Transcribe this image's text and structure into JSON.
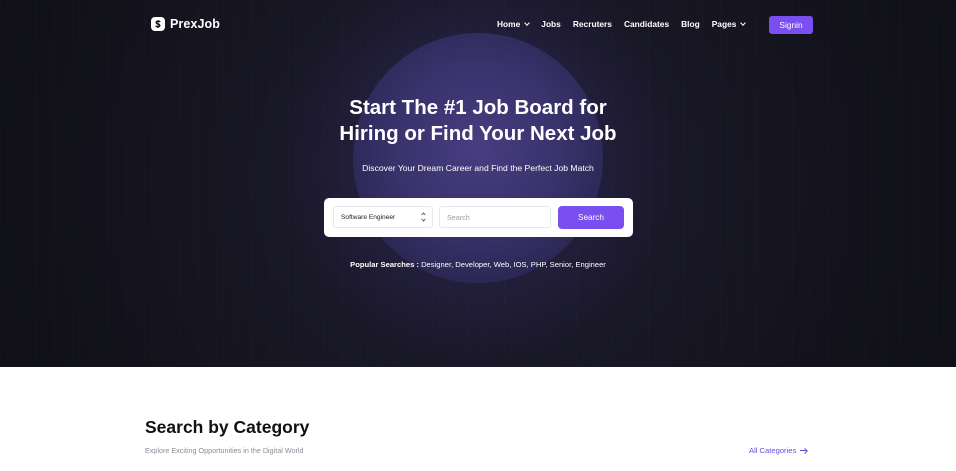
{
  "brand": {
    "name": "PrexJob",
    "logo_icon": "dollar-badge-icon"
  },
  "nav": {
    "items": [
      {
        "label": "Home",
        "has_dropdown": true
      },
      {
        "label": "Jobs",
        "has_dropdown": false
      },
      {
        "label": "Recruters",
        "has_dropdown": false
      },
      {
        "label": "Candidates",
        "has_dropdown": false
      },
      {
        "label": "Blog",
        "has_dropdown": false
      },
      {
        "label": "Pages",
        "has_dropdown": true
      }
    ],
    "signin_label": "Signin"
  },
  "hero": {
    "title_line1": "Start The #1 Job Board for",
    "title_line2": "Hiring or Find Your Next Job",
    "subtitle": "Discover Your Dream Career and Find the Perfect Job Match"
  },
  "search": {
    "category_selected": "Software Engineer",
    "input_placeholder": "Search",
    "button_label": "Search"
  },
  "popular": {
    "label": "Popular Searches :",
    "terms": [
      "Designer",
      "Developer",
      "Web",
      "IOS",
      "PHP",
      "Senior",
      "Engineer"
    ]
  },
  "category_section": {
    "title": "Search by Category",
    "subtitle": "Explore Exciting Opportunities in the Digital World",
    "link_label": "All Categories"
  },
  "colors": {
    "accent": "#7a4ff0",
    "hero_bg": "#15141f",
    "link": "#6b49e0"
  }
}
